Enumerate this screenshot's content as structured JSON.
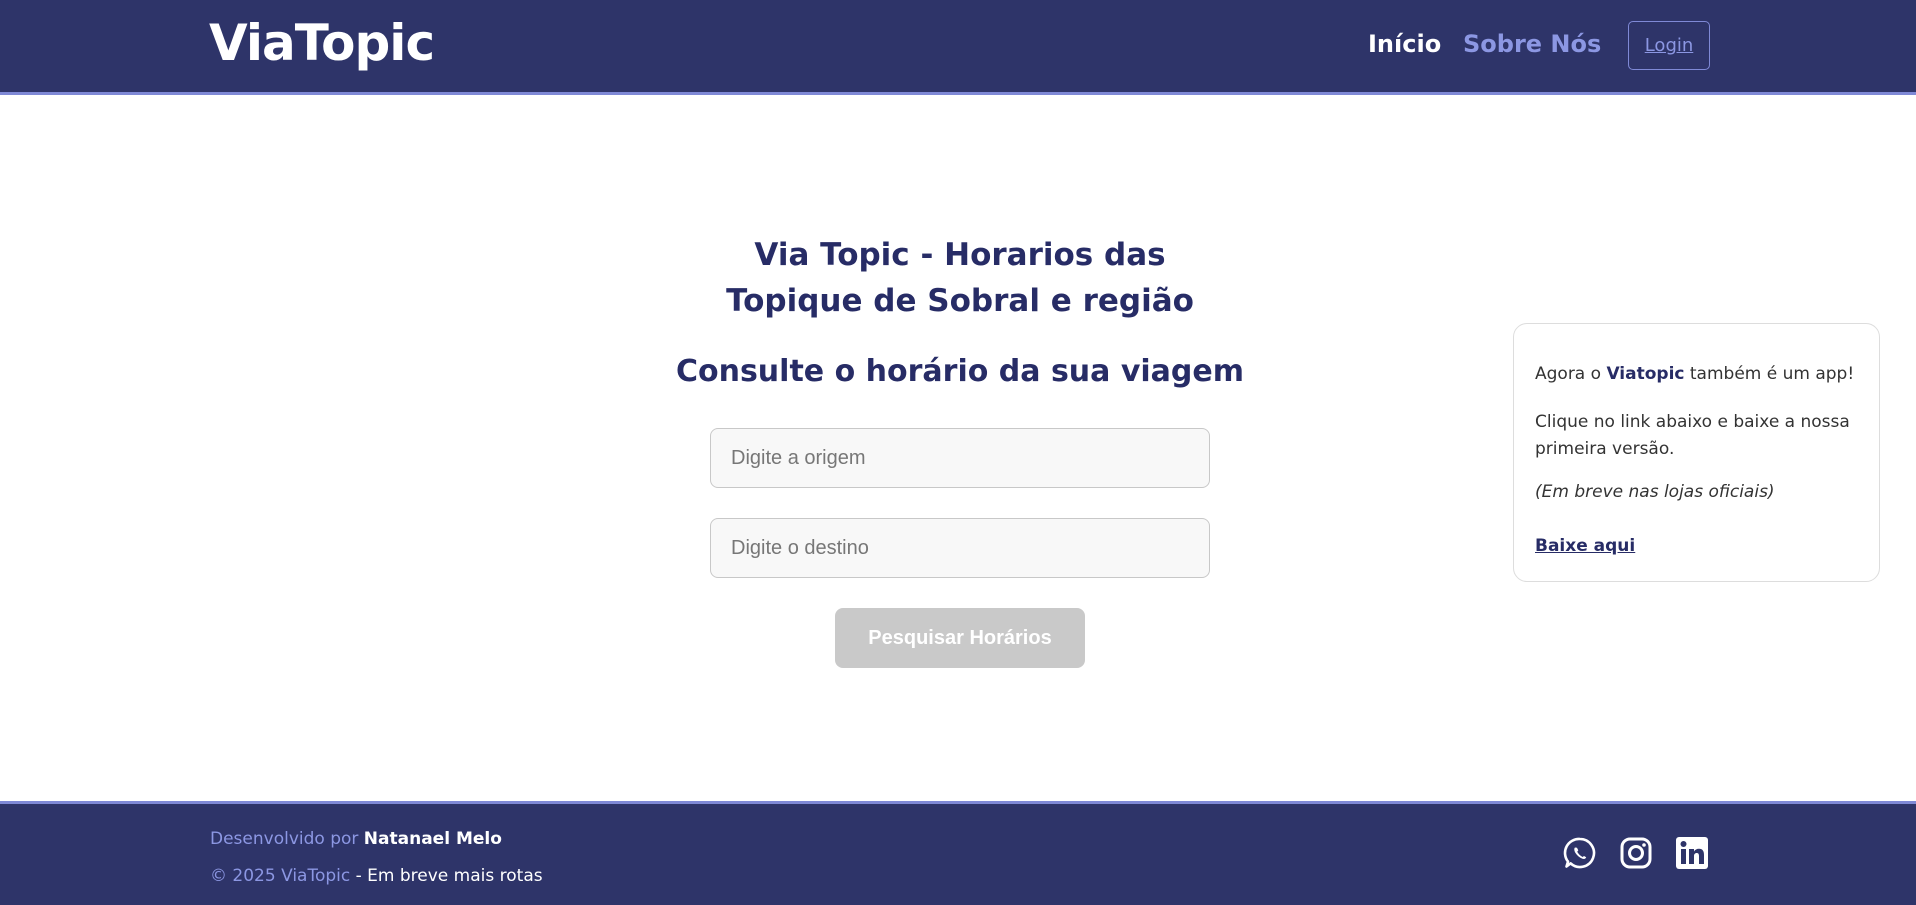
{
  "header": {
    "brand": "ViaTopic",
    "nav": {
      "home": "Início",
      "about": "Sobre Nós",
      "login": "Login"
    }
  },
  "main": {
    "title": "Via Topic - Horarios das Topique de Sobral e região",
    "subtitle": "Consulte o horário da sua viagem",
    "origin_placeholder": "Digite a origem",
    "origin_value": "",
    "destination_placeholder": "Digite o destino",
    "destination_value": "",
    "search_button": "Pesquisar Horários"
  },
  "app_card": {
    "line1_prefix": "Agora o ",
    "line1_bold": "Viatopic",
    "line1_suffix": " também é um app!",
    "line2": "Clique no link abaixo e baixe a nossa primeira versão.",
    "line3": "(Em breve nas lojas oficiais)",
    "download_link": "Baixe aqui"
  },
  "footer": {
    "dev_prefix": "Desenvolvido por ",
    "dev_name": "Natanael Melo",
    "copyright": "© 2025 ViaTopic",
    "tagline": " - Em breve mais rotas",
    "social_icons": [
      "whatsapp-icon",
      "instagram-icon",
      "linkedin-icon"
    ]
  },
  "colors": {
    "primary": "#2e3469",
    "accent": "#8c97e3",
    "heading": "#272c66",
    "button_disabled": "#c9c9c9"
  }
}
